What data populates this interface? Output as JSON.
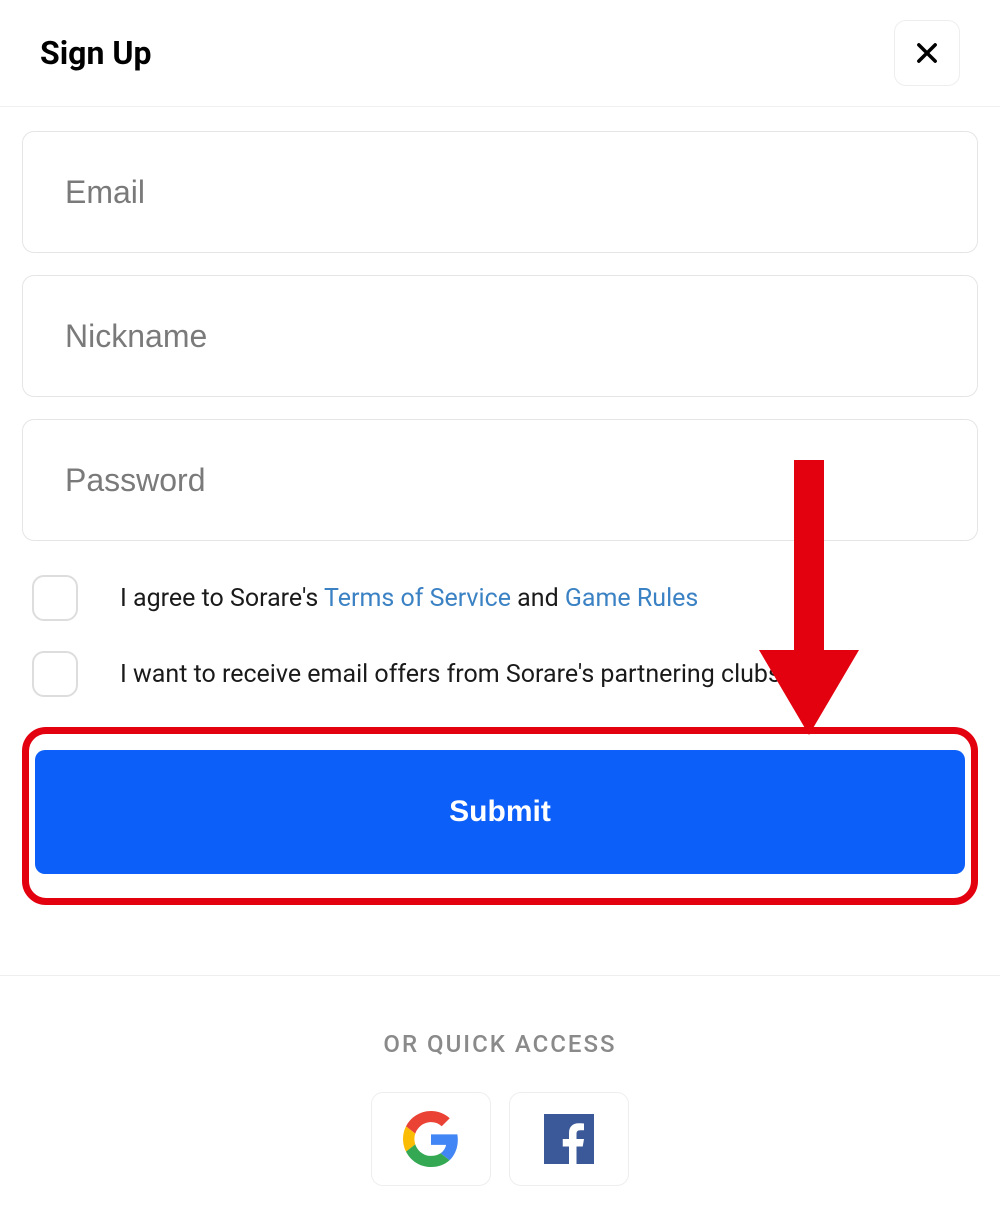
{
  "header": {
    "title": "Sign Up"
  },
  "form": {
    "email_placeholder": "Email",
    "nickname_placeholder": "Nickname",
    "password_placeholder": "Password",
    "terms": {
      "prefix": "I agree to Sorare's ",
      "tos_label": "Terms of Service",
      "middle": " and ",
      "rules_label": "Game Rules"
    },
    "offers_label": "I want to receive email offers from Sorare's partnering clubs.",
    "submit_label": "Submit"
  },
  "quick_access": {
    "label": "OR QUICK ACCESS"
  },
  "colors": {
    "primary": "#0d5ff9",
    "highlight": "#e3000f",
    "link": "#3b82c4"
  }
}
